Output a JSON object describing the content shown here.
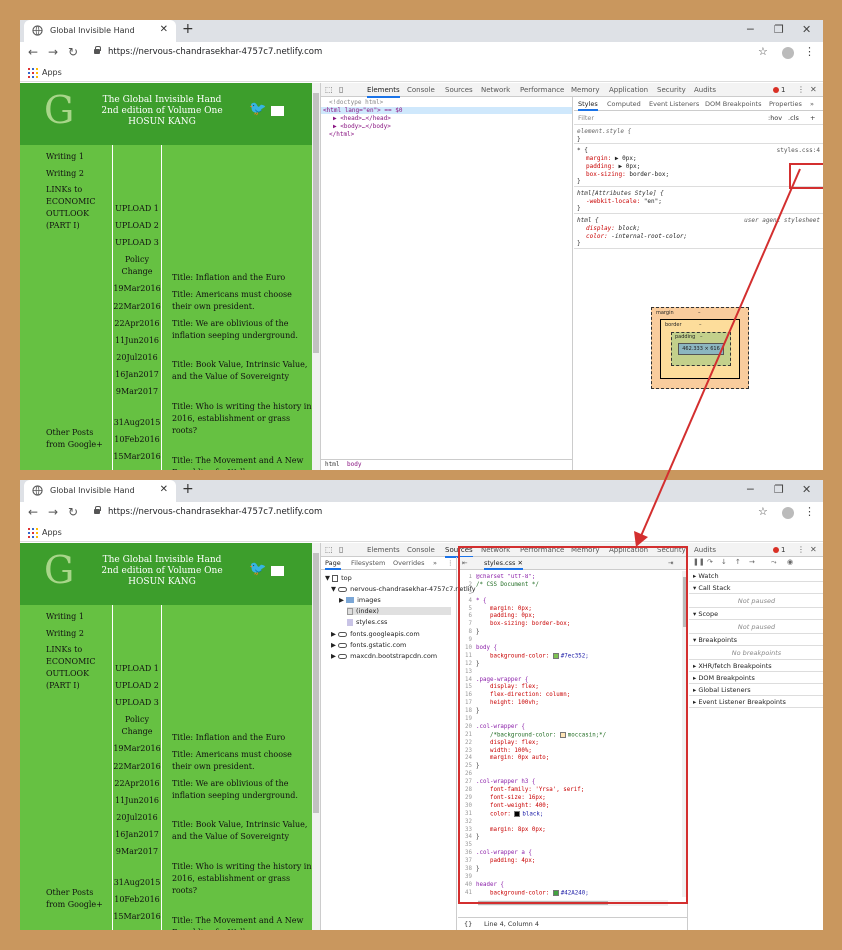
{
  "browser": {
    "tab_title": "Global Invisible Hand",
    "url": "https://nervous-chandrasekhar-4757c7.netlify.com",
    "bookmark_apps": "Apps"
  },
  "site": {
    "logo_letter": "G",
    "header_lines": [
      "The Global Invisible Hand",
      "2nd edition of Volume One",
      "HOSUN KANG"
    ],
    "col1": [
      "Writing 1",
      "Writing 2",
      "LINKs to ECONOMIC OUTLOOK (PART I)",
      "Other Posts from Google+"
    ],
    "col2": [
      "UPLOAD 1",
      "UPLOAD 2",
      "UPLOAD 3",
      "Policy Change",
      "19Mar2016",
      "22Mar2016",
      "22Apr2016",
      "11Jun2016",
      "20Jul2016",
      "16Jan2017",
      "9Mar2017",
      "31Aug2015",
      "10Feb2016",
      "15Mar2016"
    ],
    "col3": [
      "Title: Inflation and the Euro",
      "Title: Americans must choose their own president.",
      "Title: We are oblivious of the inflation seeping underground.",
      "Title: Book Value, Intrinsic Value, and the Value of Sovereignty",
      "Title: Who is writing the history in 2016, establishment or grass roots?",
      "Title: The Movement and A New Republic of a Well"
    ]
  },
  "devtools": {
    "tabs": [
      "Elements",
      "Console",
      "Sources",
      "Network",
      "Performance",
      "Memory",
      "Application",
      "Security",
      "Audits"
    ],
    "error_count": "1",
    "elements": {
      "lines": [
        "<!doctype html>",
        "<html lang=\"en\"> == $0",
        "<head>…</head>",
        "<body>…</body>",
        "</html>"
      ],
      "crumbs": [
        "html",
        "body"
      ]
    },
    "styles": {
      "tabs": [
        "Styles",
        "Computed",
        "Event Listeners",
        "DOM Breakpoints",
        "Properties"
      ],
      "filter_placeholder": "Filter",
      "hov": ":hov",
      "cls": ".cls",
      "element_style": "element.style {",
      "star_rule_selector": "* {",
      "star_rule_link": "styles.css:4",
      "star_props": [
        [
          "margin",
          "▶ 0px;"
        ],
        [
          "padding",
          "▶ 0px;"
        ],
        [
          "box-sizing",
          "border-box;"
        ]
      ],
      "attr_rule_selector": "html[Attributes Style] {",
      "attr_props": [
        [
          "-webkit-locale",
          "\"en\";"
        ]
      ],
      "ua_rule_selector": "html {",
      "ua_label": "user agent stylesheet",
      "ua_props": [
        [
          "display",
          "block;"
        ],
        [
          "color",
          "-internal-root-color;"
        ]
      ],
      "box_model": {
        "margin": "margin",
        "border": "border",
        "padding": "padding",
        "content": "462.333 × 616",
        "dash": "–"
      }
    },
    "sources": {
      "nav_tabs": [
        "Page",
        "Filesystem",
        "Overrides"
      ],
      "tree": [
        "top",
        "nervous-chandrasekhar-4757c7.netlify",
        "images",
        "(index)",
        "styles.css",
        "fonts.googleapis.com",
        "fonts.gstatic.com",
        "maxcdn.bootstrapcdn.com"
      ],
      "file_tab": "styles.css",
      "status": "Line 4, Column 4",
      "debugger": {
        "sections": [
          "Watch",
          "Call Stack",
          "Scope",
          "Breakpoints",
          "XHR/fetch Breakpoints",
          "DOM Breakpoints",
          "Global Listeners",
          "Event Listener Breakpoints"
        ],
        "not_paused": "Not paused",
        "no_breakpoints": "No breakpoints"
      }
    }
  },
  "code_lines": [
    [
      "1",
      "@charset \"utf-8\";",
      "sel"
    ],
    [
      "2",
      "/* CSS Document */",
      "cmt"
    ],
    [
      "3",
      "",
      ""
    ],
    [
      "4",
      "* {",
      "sel"
    ],
    [
      "5",
      "    margin: 0px;",
      "prp"
    ],
    [
      "6",
      "    padding: 0px;",
      "prp"
    ],
    [
      "7",
      "    box-sizing: border-box;",
      "prp"
    ],
    [
      "8",
      "}",
      ""
    ],
    [
      "9",
      "",
      ""
    ],
    [
      "10",
      "body {",
      "sel"
    ],
    [
      "11",
      "    background-color: ■#7ec352;",
      "prp"
    ],
    [
      "12",
      "}",
      ""
    ],
    [
      "13",
      "",
      ""
    ],
    [
      "14",
      ".page-wrapper {",
      "sel"
    ],
    [
      "15",
      "    display: flex;",
      "prp"
    ],
    [
      "16",
      "    flex-direction: column;",
      "prp"
    ],
    [
      "17",
      "    height: 100vh;",
      "prp"
    ],
    [
      "18",
      "}",
      ""
    ],
    [
      "19",
      "",
      ""
    ],
    [
      "20",
      ".col-wrapper {",
      "sel"
    ],
    [
      "21",
      "    /*background-color: ■moccasin;*/",
      "cmt"
    ],
    [
      "22",
      "    display: flex;",
      "prp"
    ],
    [
      "23",
      "    width: 100%;",
      "prp"
    ],
    [
      "24",
      "    margin: 0px auto;",
      "prp"
    ],
    [
      "25",
      "}",
      ""
    ],
    [
      "26",
      "",
      ""
    ],
    [
      "27",
      ".col-wrapper h3 {",
      "sel"
    ],
    [
      "28",
      "    font-family: 'Yrsa', serif;",
      "prp"
    ],
    [
      "29",
      "    font-size: 16px;",
      "prp"
    ],
    [
      "30",
      "    font-weight: 400;",
      "prp"
    ],
    [
      "31",
      "    color: ■black;",
      "prp"
    ],
    [
      "32",
      "",
      ""
    ],
    [
      "33",
      "    margin: 8px 0px;",
      "prp"
    ],
    [
      "34",
      "}",
      ""
    ],
    [
      "35",
      "",
      ""
    ],
    [
      "36",
      ".col-wrapper a {",
      "sel"
    ],
    [
      "37",
      "    padding: 4px;",
      "prp"
    ],
    [
      "38",
      "}",
      ""
    ],
    [
      "39",
      "",
      ""
    ],
    [
      "40",
      "header {",
      "sel"
    ],
    [
      "41",
      "    background-color: ■#42A240;",
      "prp"
    ]
  ],
  "colors": {
    "site_bg": "#66c142",
    "header_bg": "#3d9e2c",
    "callout": "#d32f2f",
    "body_bg_swatch": "#7ec352",
    "header_swatch": "#42A240",
    "moccasin": "#ffe4b5"
  }
}
